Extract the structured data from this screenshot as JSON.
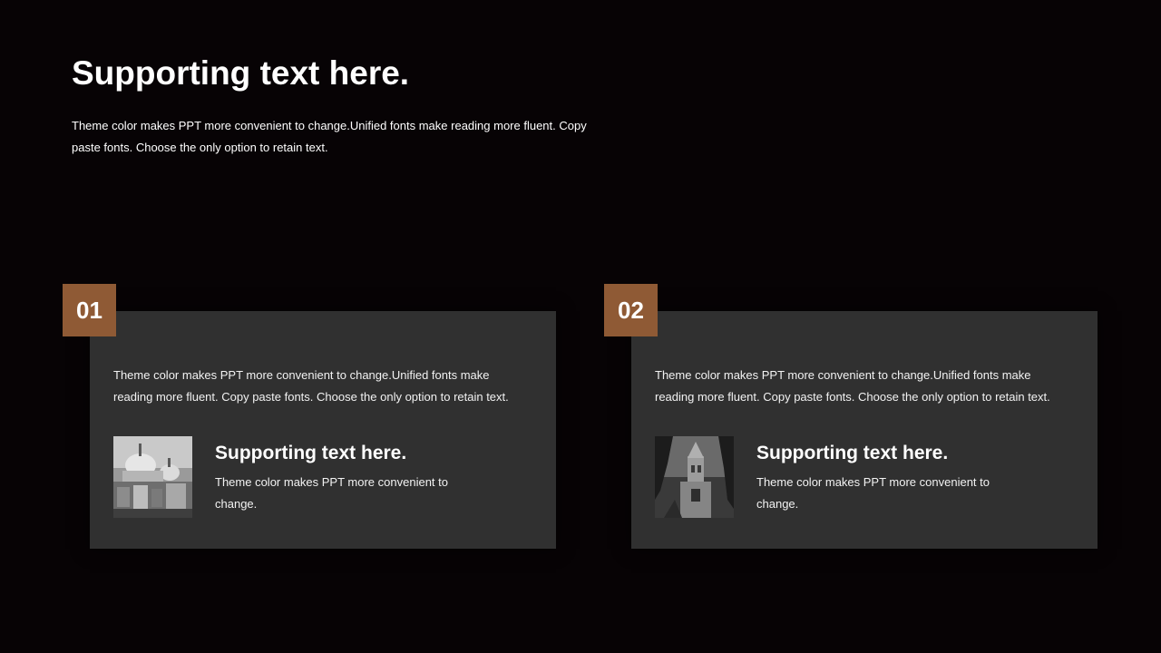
{
  "slide": {
    "title": "Supporting text here.",
    "intro": "Theme  color makes PPT more convenient  to change.Unified  fonts make  reading more fluent. Copy paste  fonts. Choose  the only  option to retain text."
  },
  "accent_color": "#8f5a35",
  "card_color": "#303030",
  "cards": [
    {
      "number": "01",
      "body": "Theme  color makes PPT more convenient  to change.Unified  fonts make  reading more fluent. Copy paste  fonts. Choose  the only  option to retain text.",
      "image": "venice-basilica-photo",
      "subtitle": "Supporting text here.",
      "subtext": "Theme  color makes PPT more convenient  to change."
    },
    {
      "number": "02",
      "body": "Theme  color makes PPT more convenient  to change.Unified  fonts make  reading more fluent. Copy paste  fonts. Choose  the only  option to retain text.",
      "image": "church-tower-photo",
      "subtitle": "Supporting text here.",
      "subtext": "Theme  color makes PPT more convenient  to change."
    }
  ]
}
